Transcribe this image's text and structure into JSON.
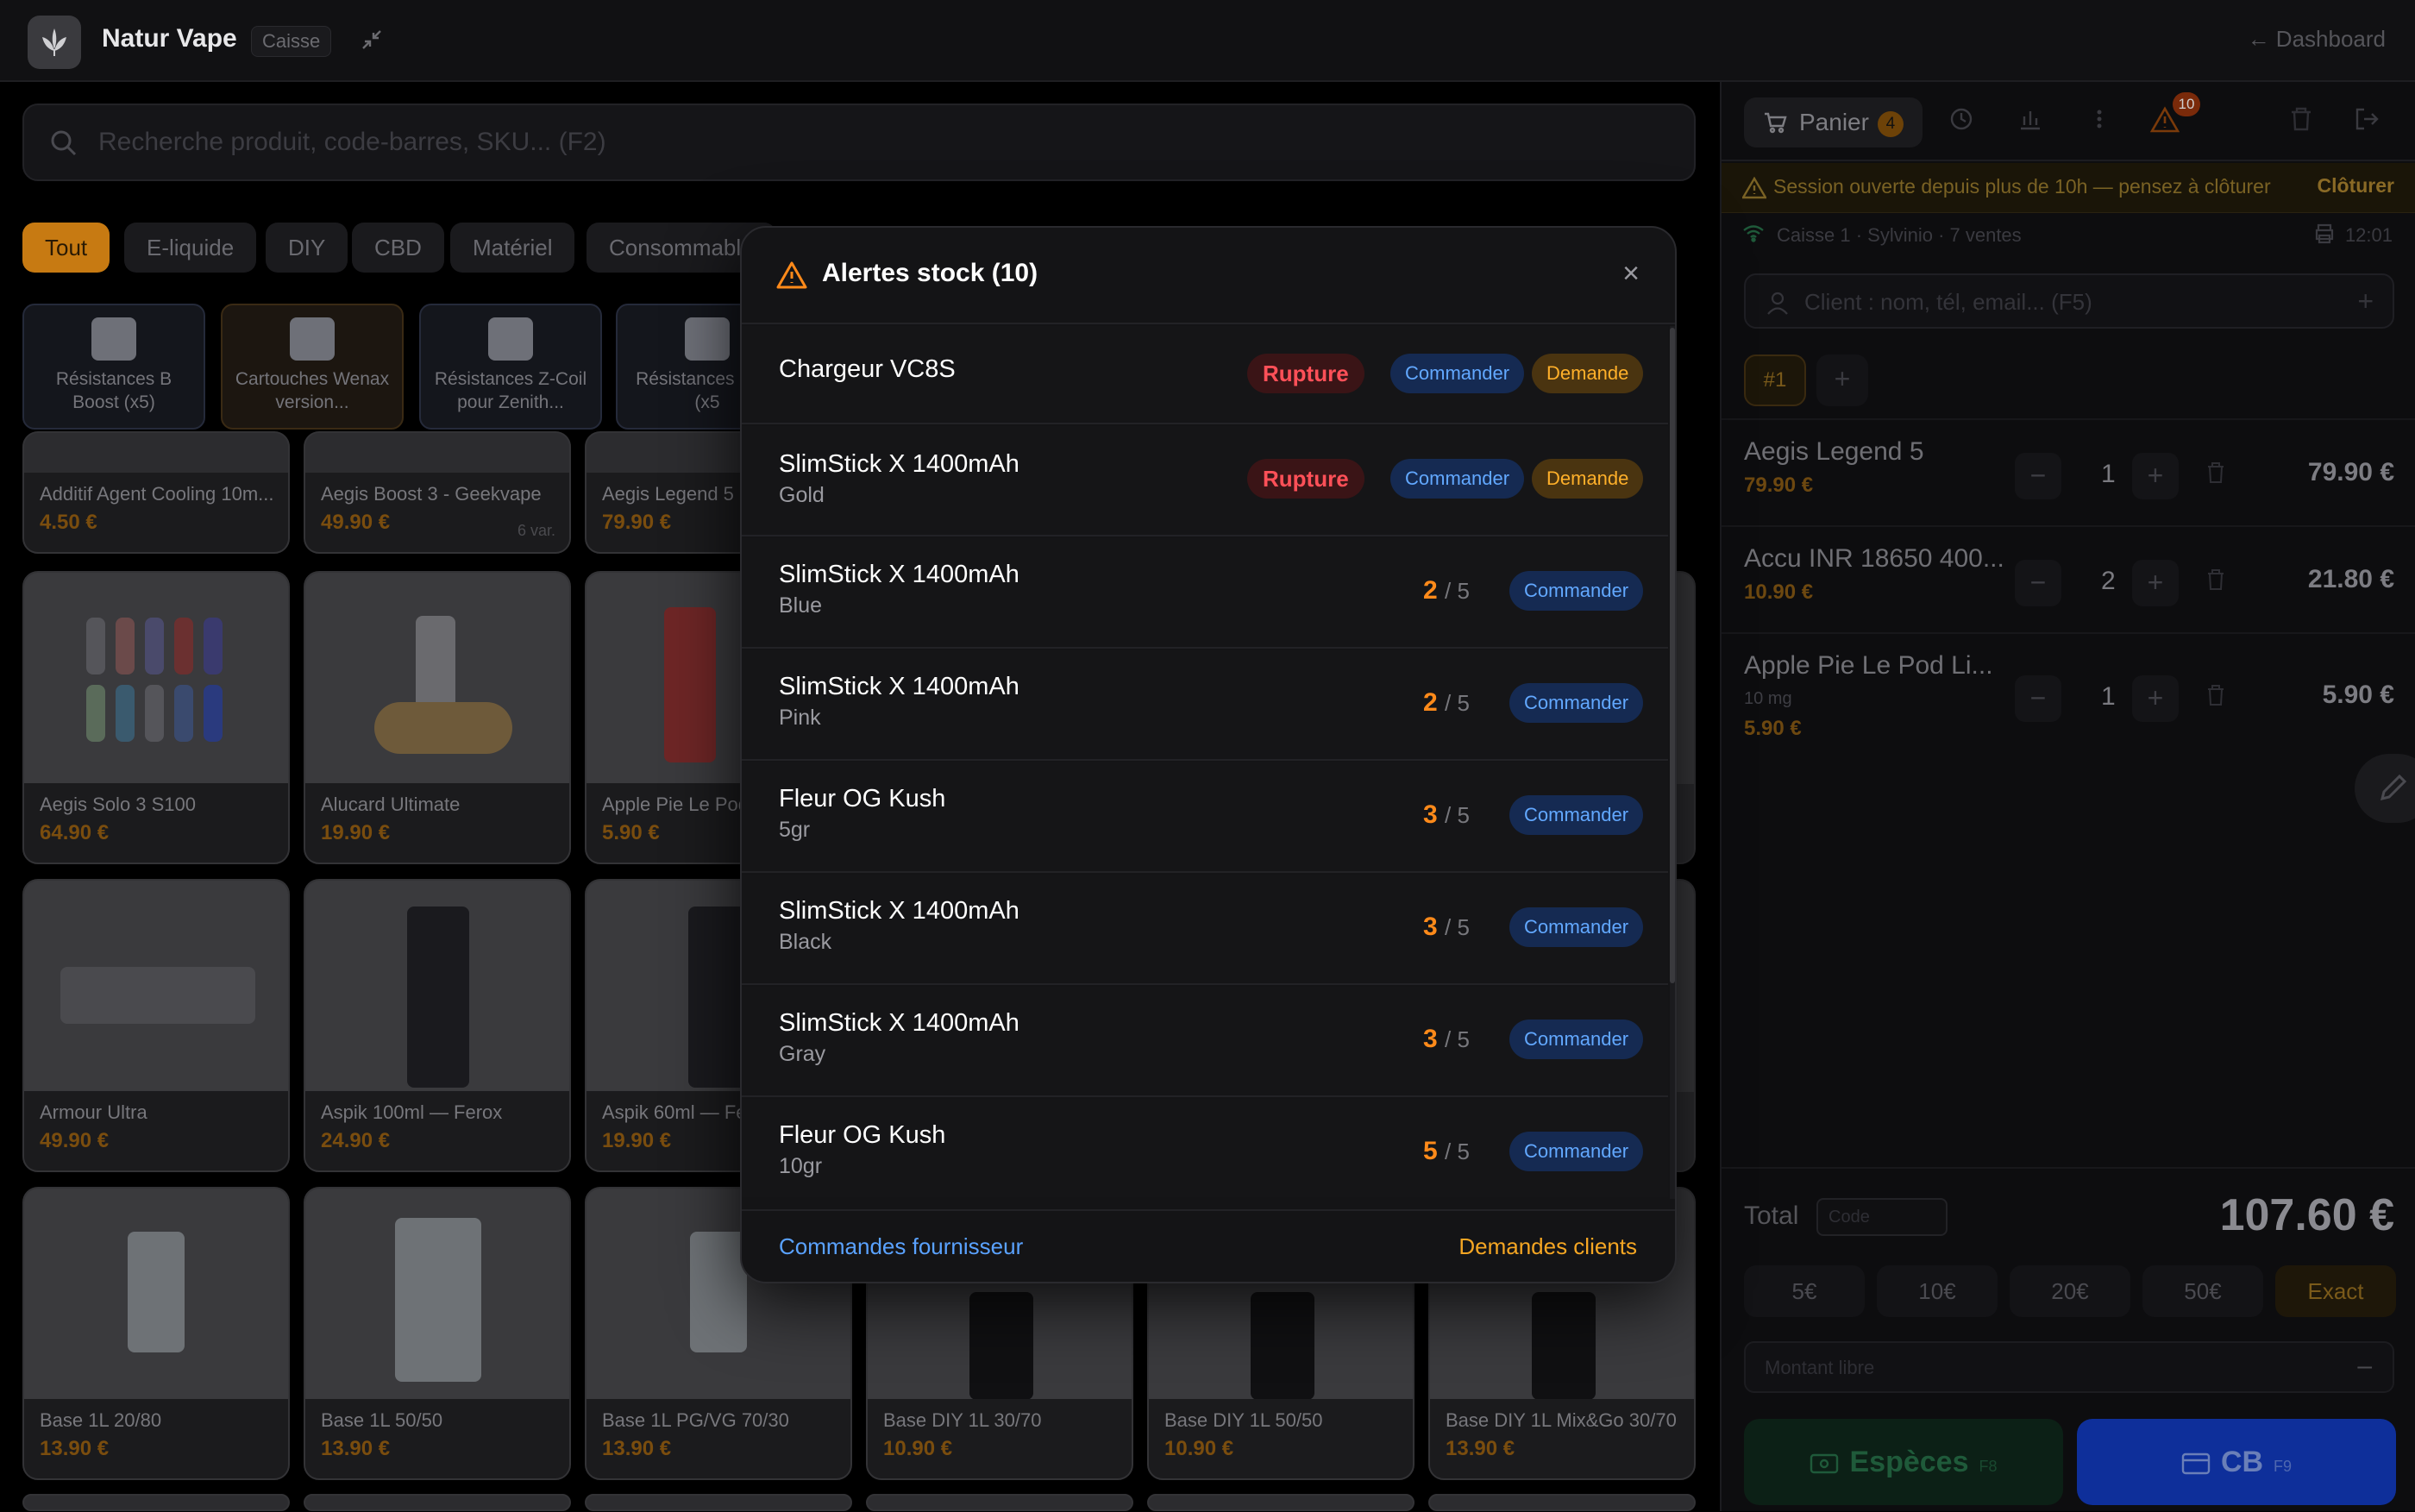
{
  "app": {
    "name": "Natur Vape",
    "badge": "Caisse",
    "dashboard": "← Dashboard"
  },
  "search": {
    "placeholder": "Recherche produit, code-barres, SKU... (F2)"
  },
  "categories": [
    "Tout",
    "E-liquide",
    "DIY",
    "CBD",
    "Matériel",
    "Consommable"
  ],
  "subcategories": [
    {
      "label": "Résistances B Boost (x5)"
    },
    {
      "label": "Cartouches Wenax version..."
    },
    {
      "label": "Résistances Z-Coil pour Zenith..."
    },
    {
      "label": "Résistances X V2 (x5"
    }
  ],
  "products": [
    {
      "name": "Additif Agent Cooling 10m...",
      "price": "4.50 €"
    },
    {
      "name": "Aegis Boost 3 - Geekvape",
      "price": "49.90 €",
      "variants": "6 var."
    },
    {
      "name": "Aegis Legend 5",
      "price": "79.90 €"
    },
    {
      "name": "Aegis Solo 3 S100",
      "price": "64.90 €"
    },
    {
      "name": "Alucard Ultimate",
      "price": "19.90 €"
    },
    {
      "name": "Apple Pie Le Pod",
      "price": "5.90 €"
    },
    {
      "name": "Armour Ultra",
      "price": "49.90 €"
    },
    {
      "name": "Aspik 100ml — Ferox",
      "price": "24.90 €"
    },
    {
      "name": "Aspik 60ml — Fer",
      "price": "19.90 €"
    },
    {
      "name": "Base 1L 20/80",
      "price": "13.90 €"
    },
    {
      "name": "Base 1L 50/50",
      "price": "13.90 €"
    },
    {
      "name": "Base 1L PG/VG 70/30",
      "price": "13.90 €"
    },
    {
      "name": "Base DIY 1L 30/70",
      "price": "10.90 €"
    },
    {
      "name": "Base DIY 1L 50/50",
      "price": "10.90 €"
    },
    {
      "name": "Base DIY 1L Mix&Go 30/70",
      "price": "13.90 €"
    }
  ],
  "panel": {
    "tab_label": "Panier",
    "tab_count": "4",
    "alert_count": "10",
    "session_text": "Session ouverte depuis plus de 10h — pensez à clôturer",
    "session_action": "Clôturer",
    "info": "Caisse 1 · Sylvinio · 7 ventes",
    "time": "12:01",
    "client_placeholder": "Client : nom, tél, email... (F5)",
    "ticket": "#1"
  },
  "cart": [
    {
      "name": "Aegis Legend 5",
      "sub": "",
      "unit": "79.90 €",
      "qty": "1",
      "total": "79.90 €"
    },
    {
      "name": "Accu INR 18650 400...",
      "sub": "",
      "unit": "10.90 €",
      "qty": "2",
      "total": "21.80 €"
    },
    {
      "name": "Apple Pie Le Pod Li...",
      "sub": "10 mg",
      "unit": "5.90 €",
      "qty": "1",
      "total": "5.90 €"
    }
  ],
  "totals": {
    "label": "Total",
    "code_placeholder": "Code",
    "value": "107.60 €"
  },
  "quick_cash": [
    "5€",
    "10€",
    "20€",
    "50€",
    "Exact"
  ],
  "libre": {
    "placeholder": "Montant libre",
    "sign": "–"
  },
  "pay": {
    "cash": "Espèces",
    "cash_key": "F8",
    "card": "CB",
    "card_key": "F9"
  },
  "modal": {
    "title": "Alertes stock (10)",
    "footer_left": "Commandes fournisseur",
    "footer_right": "Demandes clients",
    "order_label": "Commander",
    "request_label": "Demande",
    "rupture_label": "Rupture",
    "items": [
      {
        "name": "Chargeur VC8S",
        "variant": "",
        "status": "rupture",
        "stock": "",
        "threshold": "",
        "demand": true
      },
      {
        "name": "SlimStick X 1400mAh",
        "variant": "Gold",
        "status": "rupture",
        "stock": "",
        "threshold": "",
        "demand": true
      },
      {
        "name": "SlimStick X 1400mAh",
        "variant": "Blue",
        "status": "low",
        "stock": "2",
        "threshold": "/ 5",
        "demand": false
      },
      {
        "name": "SlimStick X 1400mAh",
        "variant": "Pink",
        "status": "low",
        "stock": "2",
        "threshold": "/ 5",
        "demand": false
      },
      {
        "name": "Fleur OG Kush",
        "variant": "5gr",
        "status": "low",
        "stock": "3",
        "threshold": "/ 5",
        "demand": false
      },
      {
        "name": "SlimStick X 1400mAh",
        "variant": "Black",
        "status": "low",
        "stock": "3",
        "threshold": "/ 5",
        "demand": false
      },
      {
        "name": "SlimStick X 1400mAh",
        "variant": "Gray",
        "status": "low",
        "stock": "3",
        "threshold": "/ 5",
        "demand": false
      },
      {
        "name": "Fleur OG Kush",
        "variant": "10gr",
        "status": "low",
        "stock": "5",
        "threshold": "/ 5",
        "demand": false
      }
    ]
  },
  "colors": {
    "accent": "#f5a623",
    "danger": "#ff5058",
    "link": "#5aa2ff",
    "card_pay": "#1a4fff"
  }
}
